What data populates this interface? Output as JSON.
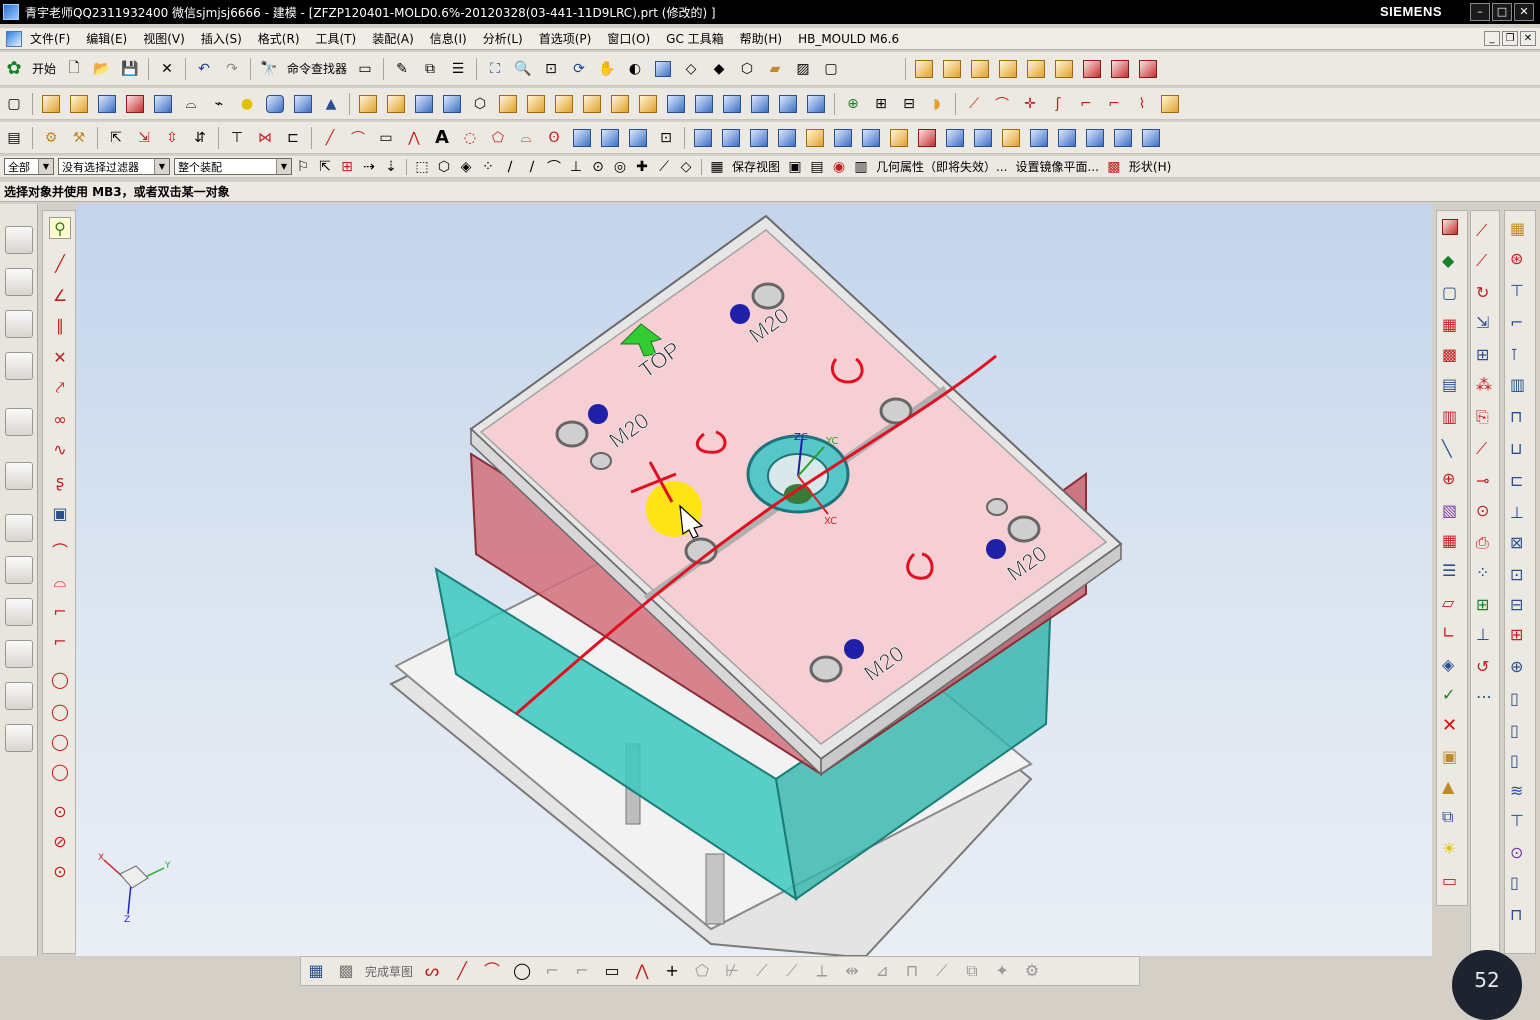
{
  "window": {
    "title": "青宇老师QQ2311932400 微信sjmjsj6666 - 建模 - [ZFZP120401-MOLD0.6%-20120328(03-441-11D9LRC).prt  (修改的) ]",
    "brand": "SIEMENS",
    "controls": {
      "minimize": "–",
      "maximize": "□",
      "close": "✕"
    }
  },
  "menu": {
    "items": [
      "文件(F)",
      "编辑(E)",
      "视图(V)",
      "插入(S)",
      "格式(R)",
      "工具(T)",
      "装配(A)",
      "信息(I)",
      "分析(L)",
      "首选项(P)",
      "窗口(O)",
      "GC 工具箱",
      "帮助(H)",
      "HB_MOULD M6.6"
    ]
  },
  "toolbar1": {
    "start_label": "开始",
    "command_finder_label": "命令查找器"
  },
  "selection_bar": {
    "type_filter": "全部",
    "selection_filter": "没有选择过滤器",
    "scope": "整个装配",
    "save_view": "保存视图",
    "geometry_props": "几何属性（即将失效）...",
    "mirror_plane": "设置镜像平面...",
    "shape_menu": "形状(H)"
  },
  "status": {
    "prompt": "选择对象并使用 MB3，或者双击某一对象"
  },
  "viewport": {
    "annotations": {
      "top_label": "TOP",
      "bolt_labels": [
        "M20",
        "M20",
        "M20",
        "M20"
      ],
      "wcs_axes": {
        "zc": "ZC",
        "yc": "YC",
        "xc": "XC"
      },
      "triad": {
        "x": "X",
        "y": "Y",
        "z": "Z"
      }
    },
    "colors": {
      "plate_top": "#f3c9cf",
      "mold_frame": "#e2e2e2",
      "cavity_plate": "#d97a84",
      "core_plate": "#37c8c0",
      "sketch_red": "#e01020",
      "highlight": "#ffe600"
    }
  },
  "sketch_toolbar": {
    "finish_label": "完成草图"
  },
  "timer": {
    "value": "52"
  }
}
